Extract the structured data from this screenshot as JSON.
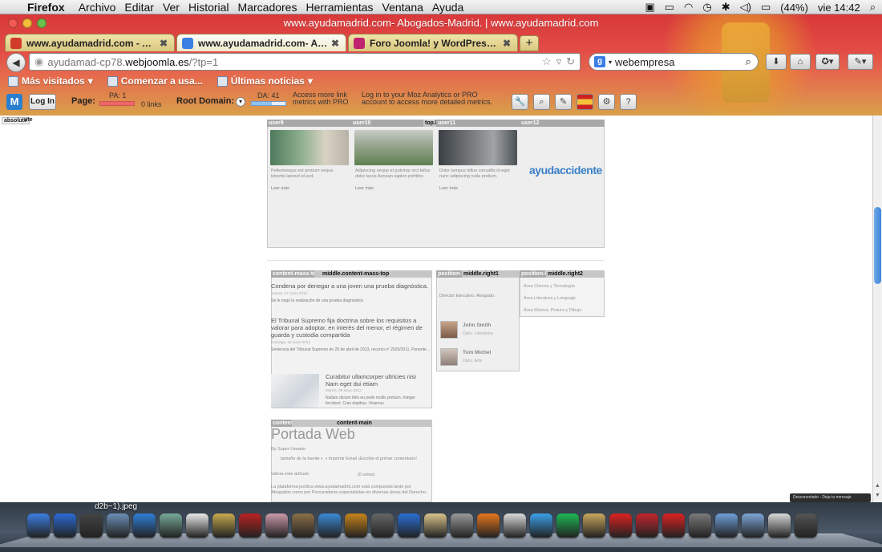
{
  "menubar": {
    "app": "Firefox",
    "items": [
      "Archivo",
      "Editar",
      "Ver",
      "Historial",
      "Marcadores",
      "Herramientas",
      "Ventana",
      "Ayuda"
    ],
    "battery": "(44%)",
    "clock": "vie 14:42"
  },
  "window": {
    "title": "www.ayudamadrid.com- Abogados-Madrid. | www.ayudamadrid.com"
  },
  "tabs": [
    {
      "label": "www.ayudamadrid.com - Admi...",
      "active": false,
      "favicon_color": "#d23a2a"
    },
    {
      "label": "www.ayudamadrid.com- Aboga...",
      "active": true,
      "favicon_color": "#3b7ee2"
    },
    {
      "label": "Foro Joomla! y WordPress :: Nue...",
      "active": false,
      "favicon_color": "#c0236f"
    }
  ],
  "navbar": {
    "url_prefix": "ayudamad-cp78.",
    "url_domain": "webjoomla.es",
    "url_suffix": "/?tp=1",
    "search_value": "webempresa"
  },
  "bookmarks": [
    "Más visitados",
    "Comenzar a usa...",
    "Últimas noticias"
  ],
  "mozbar": {
    "login": "Log In",
    "page_label": "Page:",
    "pa": "PA: 1",
    "links": "0 links",
    "root_label": "Root Domain:",
    "da": "DA: 41",
    "access_more": "Access more link metrics with PRO",
    "login_pro": "Log in to your Moz Analytics or PRO account to access more detailed metrics."
  },
  "page": {
    "absolute_tag": "absolute",
    "absolute_suffix": "ute",
    "top_module_labels": [
      "user9",
      "user10",
      "user11",
      "user12"
    ],
    "top_label": "top.b",
    "top_items": [
      {
        "text": "Pellentesque est pretium neque. lobortis laoreet id sed.",
        "leer": "Leer más"
      },
      {
        "text": "Adipiscing neque et pulvinar orci tellus dolor lacus Aenean sapien porttitor.",
        "leer": "Leer más"
      },
      {
        "text": "Dolor tempus tellus convallis id eget nunc adipiscing nulla pretium.",
        "leer": "Leer más"
      }
    ],
    "logo_text": "ayudaccidente",
    "middle_left_label": "content-mass-top",
    "middle_left_pos": "middle.content-mass-top",
    "news": [
      {
        "title": "Condena por denegar a una joven una prueba diagnóstica.",
        "date": "Jueves, 27 Junio 2013",
        "summary": "Se le negó la realización de una prueba diagnóstica"
      },
      {
        "title": "El Tribunal Supremo fija doctrina sobre los requisitos a valorar para adoptar, en interés del menor, el régimen de guarda y custodia compartida",
        "date": "Domingo, 30 Junio 2013",
        "summary": "Sentencia del Tribunal Supremo de 29 de abril de 2013, recurso nº 2525/2011. Ponente..."
      },
      {
        "title": "Curabitur ullamcorper ultricies nisi Nam eget dui etiam",
        "date": "Martes, 08 Mayo 2013",
        "summary": "Nullam dictum felis eu pede mollis pretium. Integer tincidunt. Cras dapibus. Vivamus"
      }
    ],
    "right1_label": "position-7",
    "right1_pos": "middle.right1",
    "right1_text": "Director Ejecutivo. Abogado.",
    "people": [
      {
        "name": "John Smith",
        "role": "Dpto. Literatura"
      },
      {
        "name": "Tom Michel",
        "role": "Dpto. Arte"
      }
    ],
    "right2_label": "position-5",
    "right2_pos": "middle.right2",
    "areas": [
      "Área Ciencia y Tecnología",
      "Área Literatura y Lenguaje",
      "Área Música, Pintura y Dibujo"
    ],
    "content_label": "content",
    "content_pos": "content-main",
    "portada_title": "Portada Web",
    "by_line": "By  Super Usuario",
    "tools": "tamaño de la fuente  ◐  ◑   Imprimir   Email   ¡Escribe el primer comentario!",
    "vote": "Valora este artículo",
    "votes": "(0 votos)",
    "para": "La plataforma jurídica www.ayudamadrid.com está compuesta tanto por Abogados como por Procuradores especialistas en diversas áreas del Derecho."
  },
  "toast": "Desconectado - Deja tu mensaje",
  "dock": {
    "download_label": "d2b~1).jpeg",
    "icon_colors": [
      "#3b7ee2",
      "#2a6bd6",
      "#444",
      "#6b8fb5",
      "#2f7fd8",
      "#7a9",
      "#e8e8e8",
      "#c7a94f",
      "#b22",
      "#c9a",
      "#8b6f47",
      "#3a8ad6",
      "#c8841c",
      "#666",
      "#2a6fd6",
      "#d9c38b",
      "#9a9a9a",
      "#e8761c",
      "#d9d9d9",
      "#3aa0e8",
      "#1db954",
      "#c9a75d",
      "#d22",
      "#c2262d",
      "#d22",
      "#7a7a7a",
      "#6fa0d8",
      "#7ea6d6",
      "#d8d8d8",
      "#555"
    ]
  }
}
